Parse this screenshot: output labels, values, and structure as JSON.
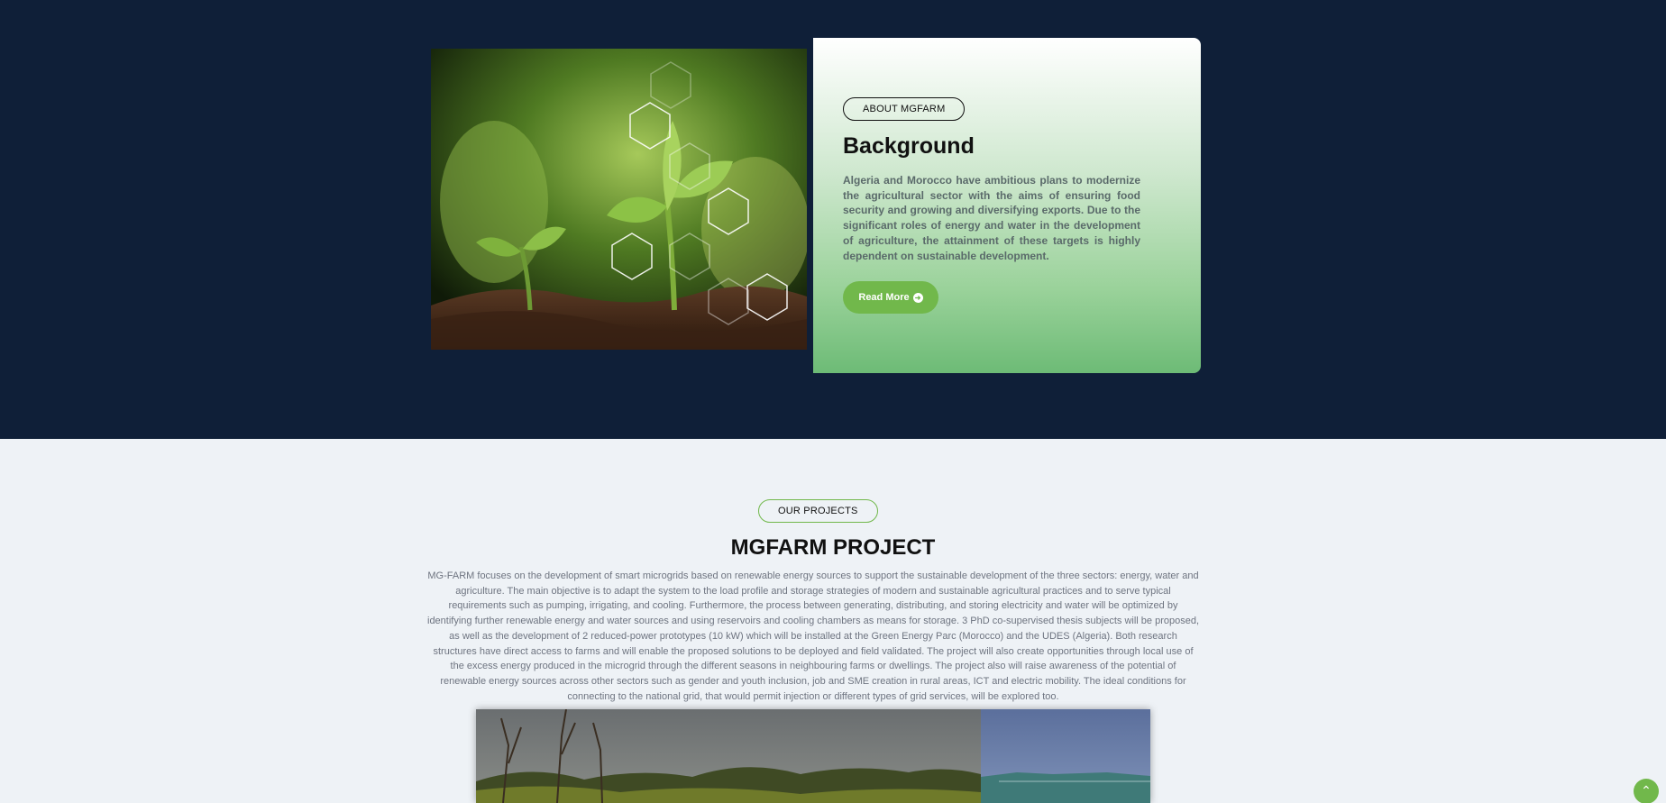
{
  "about": {
    "pill": "ABOUT MGFARM",
    "title": "Background",
    "text": "Algeria and Morocco have ambitious plans to modernize the agricultural sector with the aims of ensuring food security and growing and diversifying exports. Due to the significant roles of energy and water in the development of agriculture, the attainment of these targets is highly dependent on sustainable development.",
    "read_more": "Read More",
    "image_icons": [
      "tree-icon",
      "refresh-icon",
      "africa-map-icon",
      "leaf-icon"
    ]
  },
  "projects": {
    "pill": "OUR PROJECTS",
    "title": "MGFARM PROJECT",
    "text": "MG-FARM focuses on the development of smart microgrids based on renewable energy sources to support the sustainable development of the three sectors: energy, water and agriculture. The main objective is to adapt the system to the load profile and storage strategies of modern and sustainable agricultural practices and to serve typical requirements such as pumping, irrigating, and cooling. Furthermore, the process between generating, distributing, and storing electricity and water will be optimized by identifying further renewable energy and water sources and using reservoirs and cooling chambers as means for storage. 3 PhD co-supervised thesis subjects will be proposed, as well as the development of 2 reduced-power prototypes (10 kW) which will be installed at the Green Energy Parc (Morocco) and the UDES (Algeria). Both research structures have direct access to farms and will enable the proposed solutions to be deployed and field validated. The project will also create opportunities through local use of the excess energy produced in the microgrid through the different seasons in neighbouring farms or dwellings. The project also will raise awareness of the potential of renewable energy sources across other sectors such as gender and youth inclusion, job and SME creation in rural areas, ICT and electric mobility. The ideal conditions for connecting to the national grid, that would permit injection or different types of grid services, will be explored too."
  },
  "colors": {
    "navy": "#0f1f38",
    "accent_green": "#71b84b",
    "light_bg": "#eef2f6"
  }
}
